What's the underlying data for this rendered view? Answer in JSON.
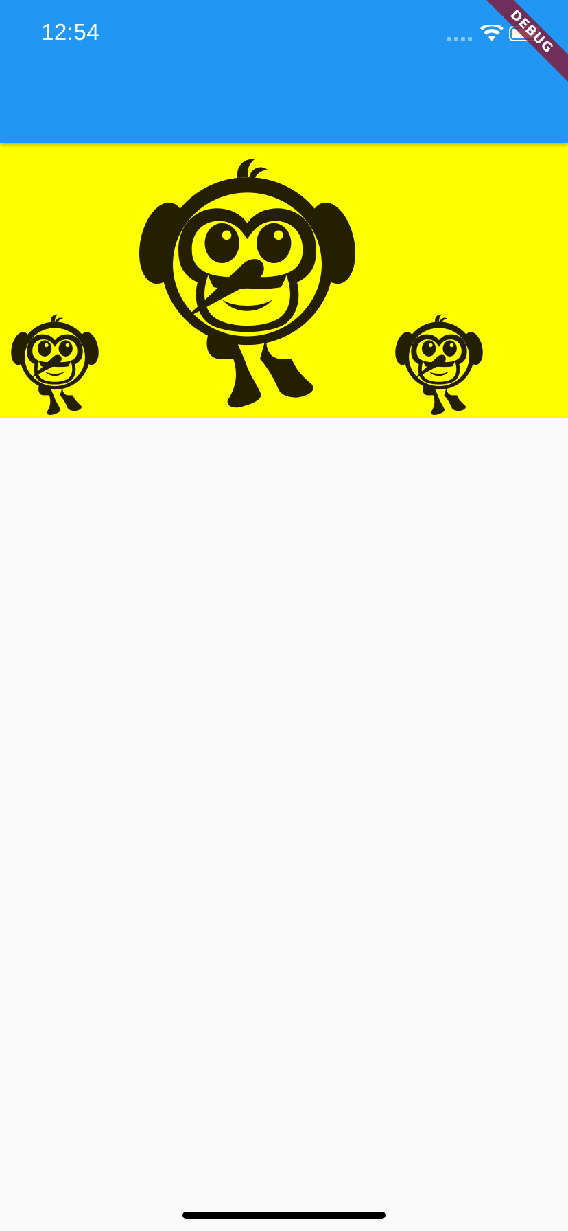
{
  "status_bar": {
    "time": "12:54",
    "icons": [
      "signal-icon",
      "wifi-icon",
      "battery-icon"
    ]
  },
  "app_bar": {
    "title": "",
    "color": "#2196F3"
  },
  "debug_banner": {
    "label": "DEBUG",
    "color": "#801838"
  },
  "banner": {
    "background": "#FFFF00",
    "images": [
      {
        "name": "bird-small-left",
        "icon": "bird-mascot"
      },
      {
        "name": "bird-large",
        "icon": "bird-mascot"
      },
      {
        "name": "bird-small-right",
        "icon": "bird-mascot"
      }
    ]
  },
  "body": {
    "background": "#FAFAFA"
  },
  "home_indicator": {
    "color": "#000000"
  }
}
